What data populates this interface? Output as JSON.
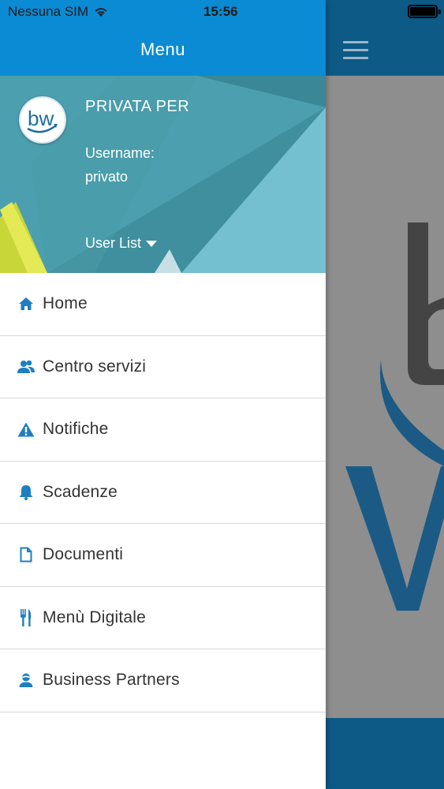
{
  "status_bar": {
    "carrier": "Nessuna SIM",
    "time": "15:56"
  },
  "drawer": {
    "title": "Menu",
    "profile": {
      "name": "PRIVATA PER",
      "username_label": "Username:",
      "username_value": "privato",
      "user_list_label": "User List"
    },
    "items": [
      {
        "label": "Home",
        "icon": "home-icon"
      },
      {
        "label": "Centro servizi",
        "icon": "users-icon"
      },
      {
        "label": "Notifiche",
        "icon": "warning-icon"
      },
      {
        "label": "Scadenze",
        "icon": "bell-icon"
      },
      {
        "label": "Documenti",
        "icon": "document-icon"
      },
      {
        "label": "Menù Digitale",
        "icon": "fork-knife-icon"
      },
      {
        "label": "Business Partners",
        "icon": "person-icon"
      }
    ]
  },
  "colors": {
    "drawer_header": "#0a8bd4",
    "icon_blue": "#1e7fc0",
    "app_header": "#0d5a86",
    "app_background": "#8e8e8e"
  }
}
